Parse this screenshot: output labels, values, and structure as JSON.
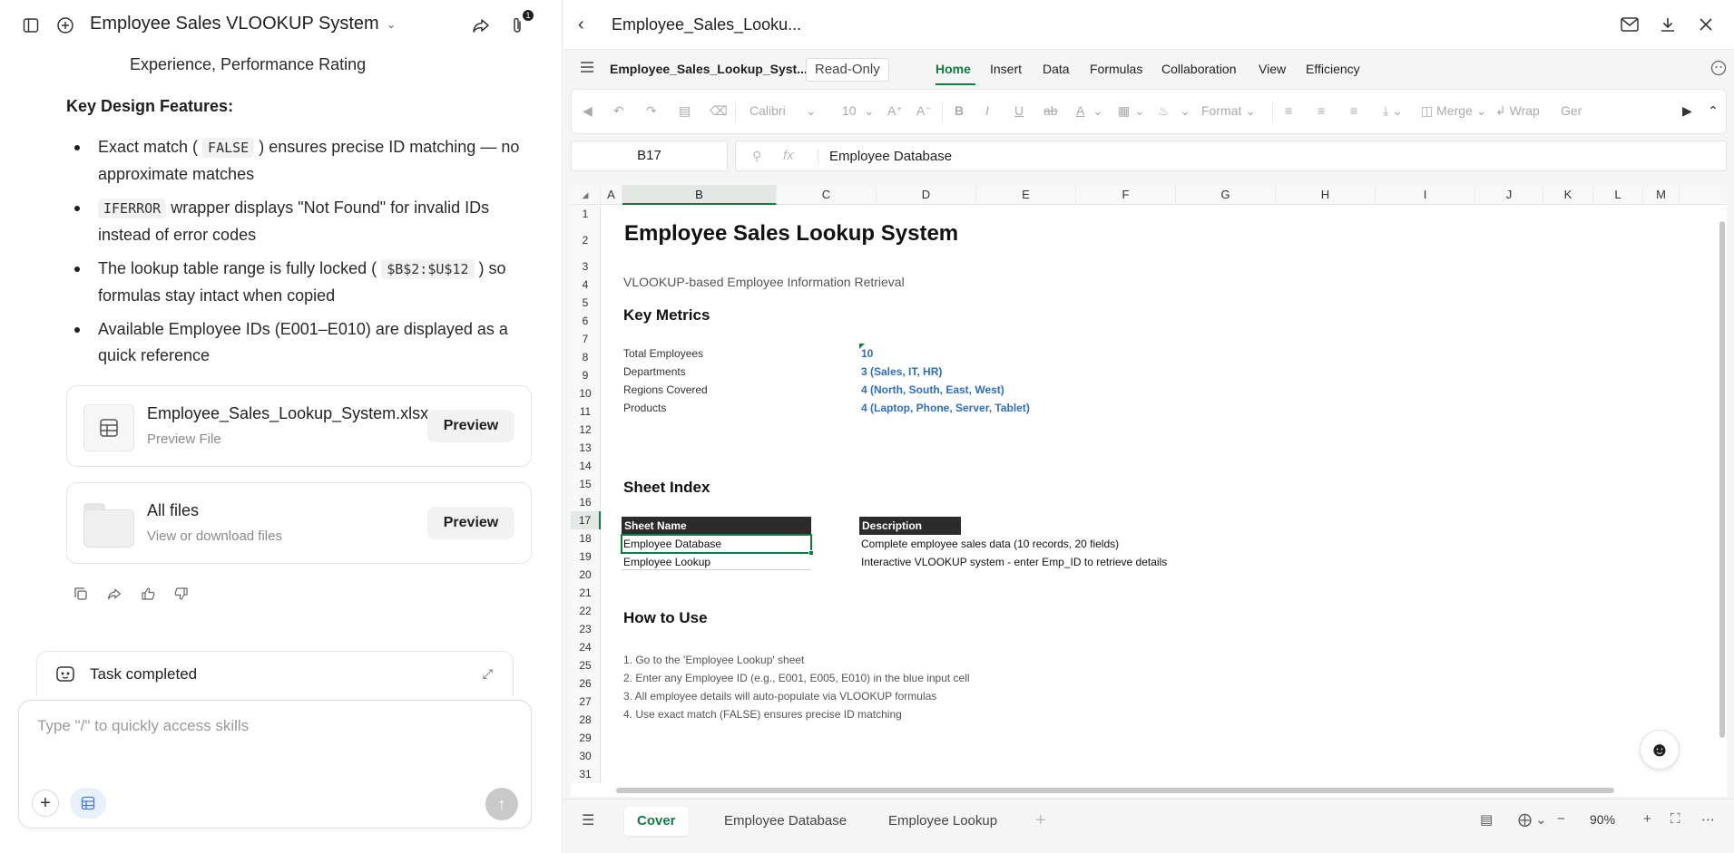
{
  "chat": {
    "title": "Employee Sales VLOOKUP System",
    "attachment_count": "1",
    "top_line": "Experience, Performance Rating",
    "key_design_title": "Key Design Features:",
    "bullets": [
      {
        "pre": "Exact match (",
        "code": "FALSE",
        "post": ") ensures precise ID matching — no approximate matches"
      },
      {
        "pre": "",
        "code": "IFERROR",
        "post": " wrapper displays \"Not Found\" for invalid IDs instead of error codes"
      },
      {
        "pre": "The lookup table range is fully locked (",
        "code": "$B$2:$U$12",
        "post": ") so formulas stay intact when copied"
      },
      {
        "pre": "Available Employee IDs (E001–E010) are displayed as a quick reference",
        "code": "",
        "post": ""
      }
    ],
    "file_card": {
      "name": "Employee_Sales_Lookup_System.xlsx",
      "sub": "Preview File",
      "button": "Preview"
    },
    "all_files_card": {
      "name": "All files",
      "sub": "View or download files",
      "button": "Preview"
    },
    "task_status": "Task completed",
    "input_placeholder": "Type \"/\" to quickly access skills"
  },
  "sheet_app": {
    "file_title": "Employee_Sales_Looku...",
    "doc_name": "Employee_Sales_Lookup_Syst...",
    "readonly_label": "Read-Only",
    "menu": [
      "Home",
      "Insert",
      "Data",
      "Formulas",
      "Collaboration",
      "View",
      "Efficiency"
    ],
    "active_menu": "Home",
    "toolbar": {
      "font": "Calibri",
      "size": "10",
      "format": "Format",
      "merge": "Merge",
      "wrap": "Wrap",
      "general": "Ger"
    },
    "name_box": "B17",
    "fx_label": "fx",
    "formula_value": "Employee Database",
    "columns": [
      "A",
      "B",
      "C",
      "D",
      "E",
      "F",
      "G",
      "H",
      "I",
      "J",
      "K",
      "L",
      "M"
    ],
    "selected_column": "B",
    "rows": [
      "1",
      "2",
      "3",
      "4",
      "5",
      "6",
      "7",
      "8",
      "9",
      "10",
      "11",
      "12",
      "13",
      "14",
      "15",
      "16",
      "17",
      "18",
      "19",
      "20",
      "21",
      "22",
      "23",
      "24",
      "25",
      "26",
      "27",
      "28",
      "29",
      "30",
      "31"
    ],
    "selected_row": "17",
    "content": {
      "title": "Employee Sales Lookup System",
      "subtitle": "VLOOKUP-based Employee Information Retrieval",
      "key_metrics_title": "Key Metrics",
      "metrics": [
        {
          "label": "Total Employees",
          "value": "10"
        },
        {
          "label": "Departments",
          "value": "3 (Sales, IT, HR)"
        },
        {
          "label": "Regions Covered",
          "value": "4 (North, South, East, West)"
        },
        {
          "label": "Products",
          "value": "4 (Laptop, Phone, Server, Tablet)"
        }
      ],
      "sheet_index_title": "Sheet Index",
      "index_headers": {
        "name": "Sheet Name",
        "desc": "Description"
      },
      "index_rows": [
        {
          "name": "Employee Database",
          "desc": "Complete employee sales data (10 records, 20 fields)"
        },
        {
          "name": "Employee Lookup",
          "desc": "Interactive VLOOKUP system - enter Emp_ID to retrieve details"
        }
      ],
      "how_to_title": "How to Use",
      "steps": [
        "1. Go to the 'Employee Lookup' sheet",
        "2. Enter any Employee ID (e.g., E001, E005, E010) in the blue input cell",
        "3. All employee details will auto-populate via VLOOKUP formulas",
        "4. Use exact match (FALSE) ensures precise ID matching"
      ]
    },
    "tabs": [
      "Cover",
      "Employee Database",
      "Employee Lookup"
    ],
    "active_tab": "Cover",
    "zoom": "90%",
    "colors": {
      "accent": "#107c41",
      "value_blue": "#2f6fbd",
      "header_dark": "#2b2b2b"
    }
  }
}
